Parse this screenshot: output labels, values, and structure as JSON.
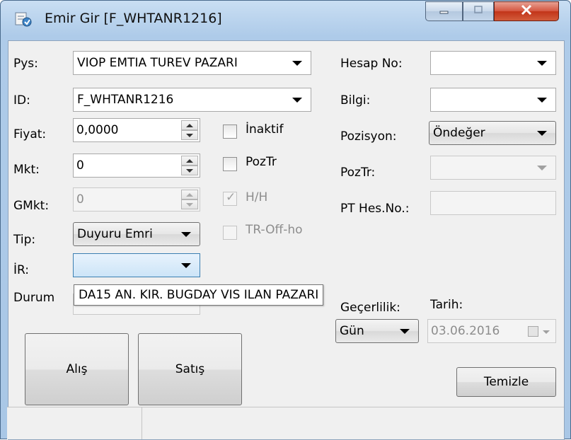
{
  "window": {
    "title": "Emir Gir [F_WHTANR1216]",
    "icons": {
      "app": "order-entry-app-icon",
      "minimize": "minimize-icon",
      "maximize": "maximize-icon",
      "close": "close-icon"
    }
  },
  "form": {
    "pys": {
      "label": "Pys:",
      "value": "VIOP EMTIA TUREV PAZARI"
    },
    "id": {
      "label": "ID:",
      "value": "F_WHTANR1216"
    },
    "fiyat": {
      "label": "Fiyat:",
      "value": "0,0000"
    },
    "mkt": {
      "label": "Mkt:",
      "value": "0"
    },
    "gmkt": {
      "label": "GMkt:",
      "value": "0"
    },
    "tip": {
      "label": "Tip:",
      "value": "Duyuru Emri"
    },
    "ir": {
      "label": "İR:",
      "value": ""
    },
    "durum": {
      "label": "Durum",
      "value": ""
    },
    "checkboxes": {
      "inaktif": {
        "label": "İnaktif",
        "checked": false,
        "enabled": true
      },
      "poztr": {
        "label": "PozTr",
        "checked": false,
        "enabled": true
      },
      "hh": {
        "label": "H/H",
        "checked": true,
        "enabled": false
      },
      "troffho": {
        "label": "TR-Off-ho",
        "checked": false,
        "enabled": false
      }
    },
    "hesap_no": {
      "label": "Hesap No:",
      "value": ""
    },
    "bilgi": {
      "label": "Bilgi:",
      "value": ""
    },
    "pozisyon": {
      "label": "Pozisyon:",
      "value": "Öndeğer"
    },
    "poztr_field": {
      "label": "PozTr:",
      "value": ""
    },
    "pt_hes_no": {
      "label": "PT Hes.No.:",
      "value": ""
    },
    "gecerlilik": {
      "label": "Geçerlilik:",
      "value": "Gün"
    },
    "tarih": {
      "label": "Tarih:",
      "value": "03.06.2016"
    }
  },
  "tooltip": {
    "text": "DA15 AN. KIR. BUGDAY VIS ILAN PAZARI"
  },
  "buttons": {
    "alis": "Alış",
    "satis": "Satış",
    "temizle": "Temizle"
  },
  "colors": {
    "title_bar": "#bcd4ee",
    "close_button": "#c8432a",
    "client_bg": "#f0f0f0"
  }
}
